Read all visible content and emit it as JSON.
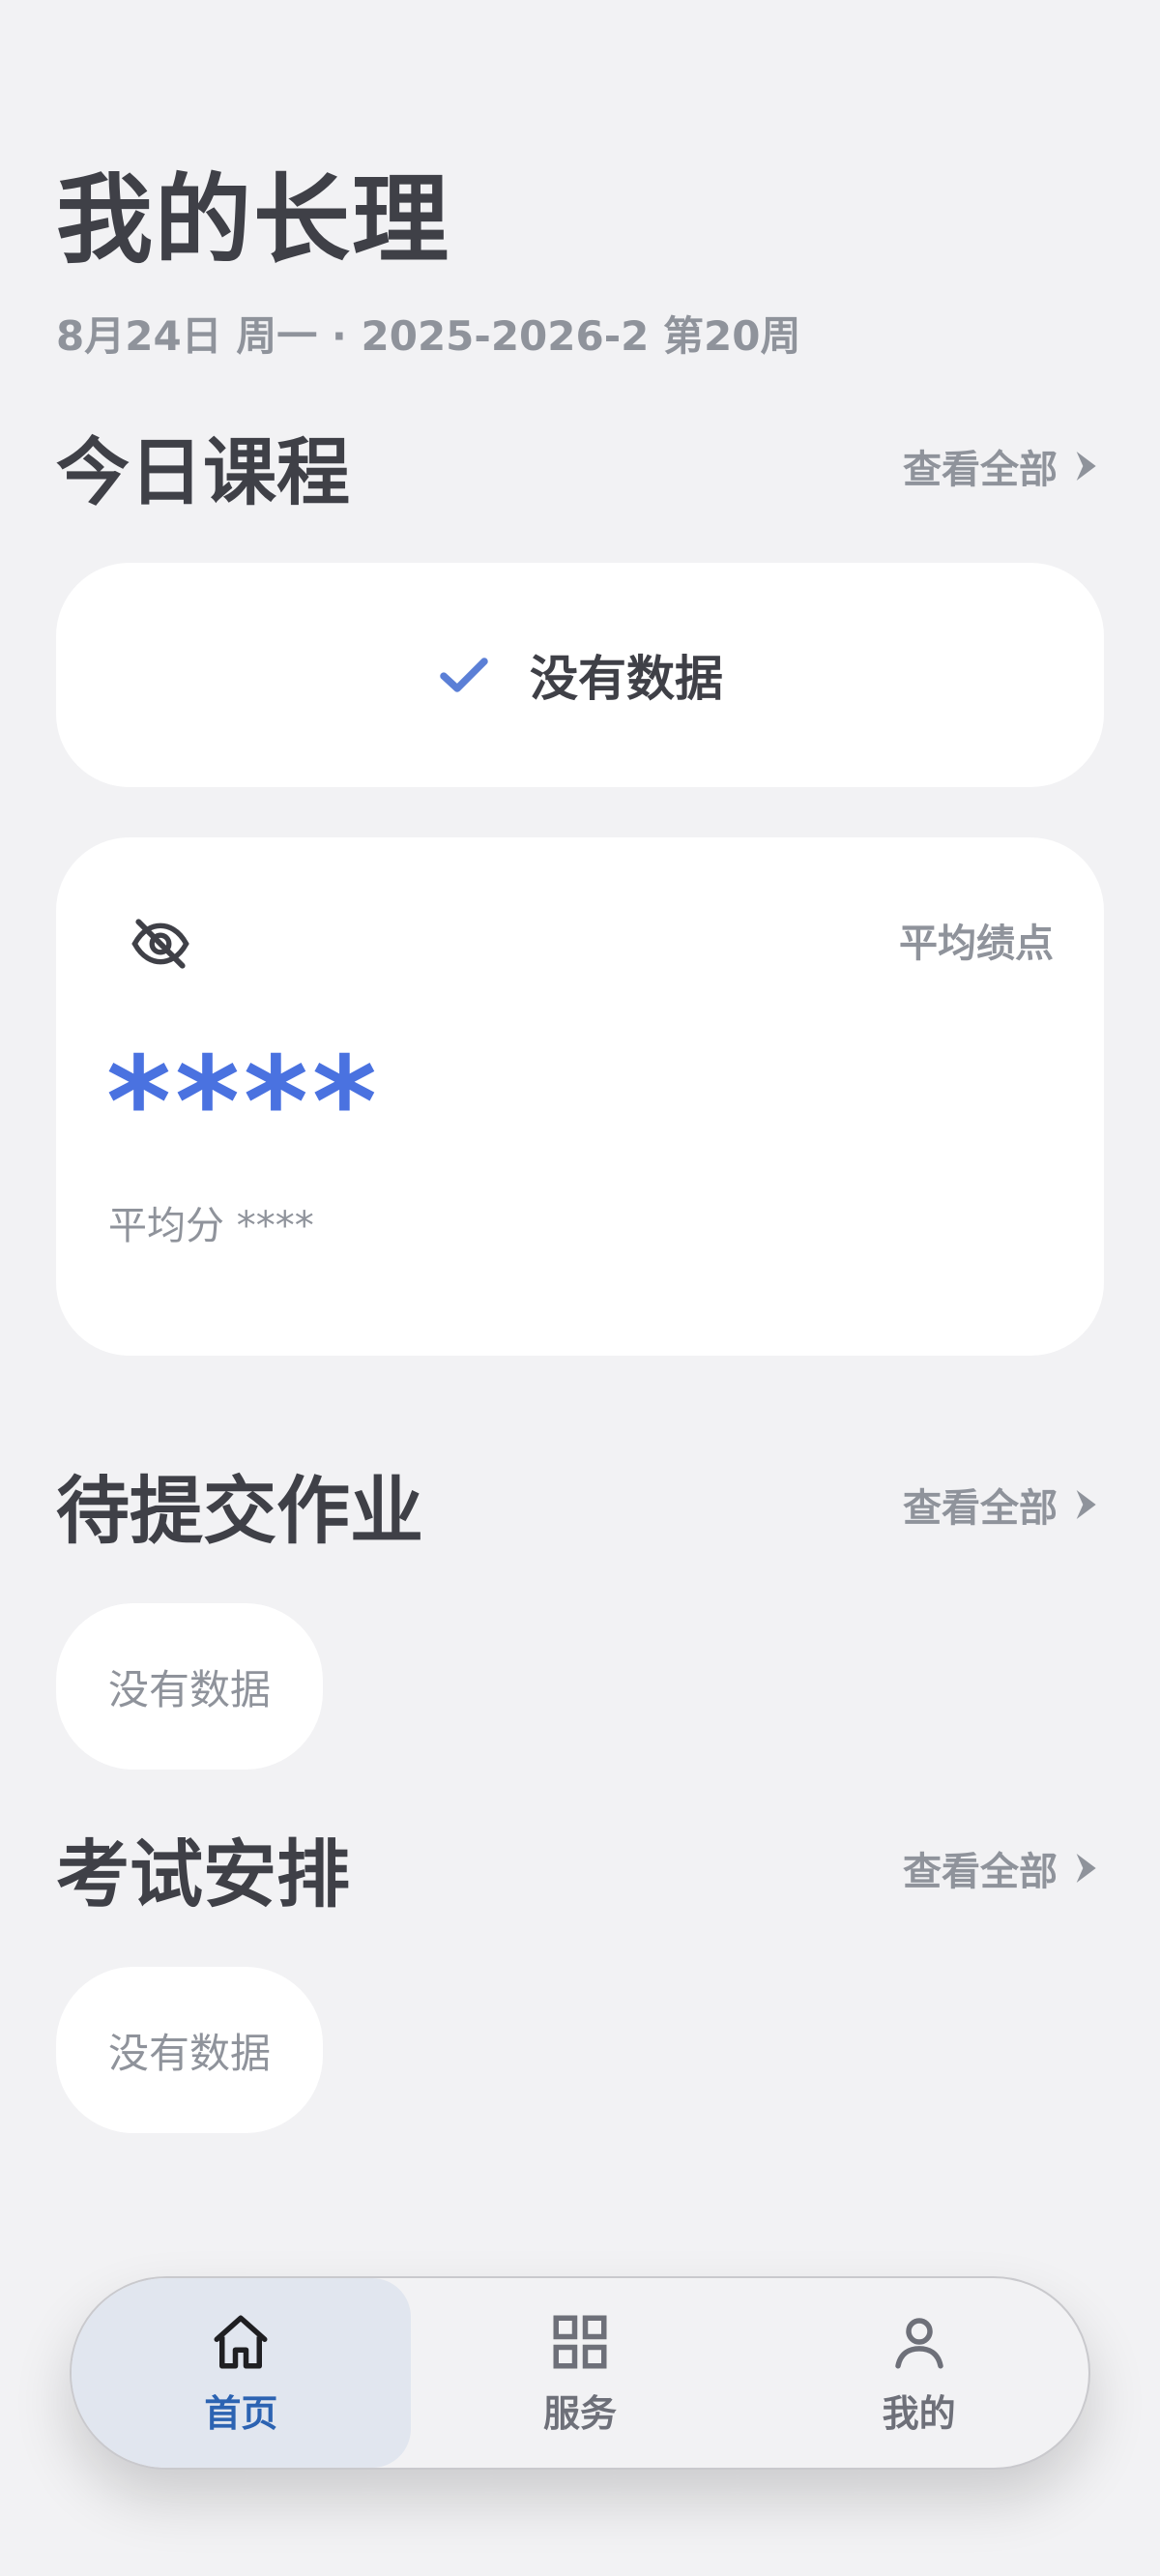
{
  "header": {
    "title": "我的长理",
    "subtitle": "8月24日 周一 · 2025-2026-2 第20周"
  },
  "today_courses": {
    "title": "今日课程",
    "view_all": "查看全部",
    "empty_text": "没有数据"
  },
  "gpa": {
    "label": "平均绩点",
    "value": "****",
    "sub": "平均分 ****"
  },
  "homework": {
    "title": "待提交作业",
    "view_all": "查看全部",
    "empty_text": "没有数据"
  },
  "exams": {
    "title": "考试安排",
    "view_all": "查看全部",
    "empty_text": "没有数据"
  },
  "tabbar": {
    "items": [
      {
        "label": "首页",
        "icon": "home-icon",
        "active": true
      },
      {
        "label": "服务",
        "icon": "grid-icon",
        "active": false
      },
      {
        "label": "我的",
        "icon": "person-icon",
        "active": false
      }
    ]
  },
  "colors": {
    "accent": "#4a72e0",
    "active_tab_text": "#2c63b2",
    "active_tab_bg": "#e1e6ef"
  }
}
